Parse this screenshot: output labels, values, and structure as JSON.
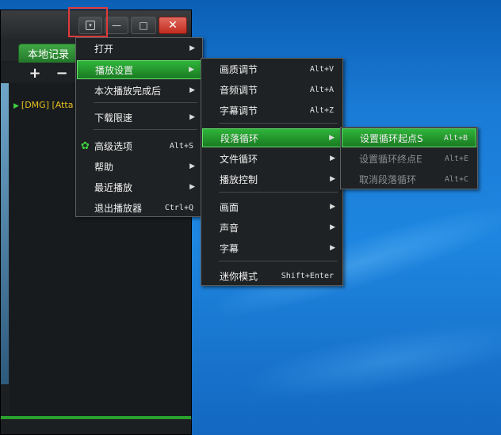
{
  "player": {
    "tab_label": "本地记录",
    "toolbar": {
      "add": "+",
      "remove": "−"
    },
    "list_items": [
      "[DMG] [Atta"
    ]
  },
  "window_buttons": {
    "menu": "▾",
    "minimize": "—",
    "maximize": "□",
    "close": "✕"
  },
  "main_menu": [
    {
      "label": "打开",
      "submenu": true
    },
    {
      "label": "播放设置",
      "submenu": true,
      "active": true
    },
    {
      "label": "本次播放完成后",
      "submenu": true
    },
    {
      "label": "下载限速",
      "submenu": true
    },
    {
      "label": "高级选项",
      "shortcut": "Alt+S",
      "icon": "gear-icon"
    },
    {
      "label": "帮助",
      "submenu": true
    },
    {
      "label": "最近播放",
      "submenu": true
    },
    {
      "label": "退出播放器",
      "shortcut": "Ctrl+Q"
    }
  ],
  "playback_menu": [
    {
      "label": "画质调节",
      "shortcut": "Alt+V"
    },
    {
      "label": "音频调节",
      "shortcut": "Alt+A"
    },
    {
      "label": "字幕调节",
      "shortcut": "Alt+Z"
    },
    {
      "label": "段落循环",
      "submenu": true,
      "active": true
    },
    {
      "label": "文件循环",
      "submenu": true
    },
    {
      "label": "播放控制",
      "submenu": true
    },
    {
      "label": "画面",
      "submenu": true
    },
    {
      "label": "声音",
      "submenu": true
    },
    {
      "label": "字幕",
      "submenu": true
    },
    {
      "label": "迷你模式",
      "shortcut": "Shift+Enter"
    }
  ],
  "loop_menu": [
    {
      "label": "设置循环起点S",
      "shortcut": "Alt+B",
      "active": true
    },
    {
      "label": "设置循环终点E",
      "shortcut": "Alt+E",
      "disabled": true
    },
    {
      "label": "取消段落循环",
      "shortcut": "Alt+C",
      "disabled": true
    }
  ],
  "colors": {
    "accent_green": "#23a02c",
    "close_red": "#c22b1f",
    "highlight_box": "#e03a3a"
  }
}
